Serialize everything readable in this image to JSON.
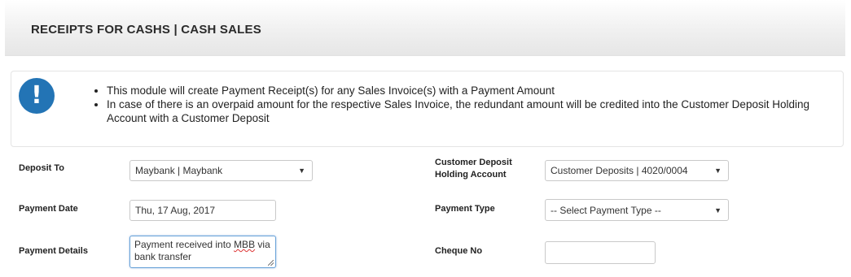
{
  "header": {
    "title": "RECEIPTS FOR CASHS | CASH SALES"
  },
  "notice": {
    "icon": "exclamation-icon",
    "items": [
      "This module will create Payment Receipt(s) for any Sales Invoice(s) with a Payment Amount",
      "In case of there is an overpaid amount for the respective Sales Invoice, the redundant amount will be credited into the Customer Deposit Holding Account with a Customer Deposit"
    ]
  },
  "form": {
    "deposit_to": {
      "label": "Deposit To",
      "value": "Maybank | Maybank"
    },
    "customer_deposit": {
      "label_line1": "Customer Deposit",
      "label_line2": "Holding Account",
      "value": "Customer Deposits | 4020/0004"
    },
    "payment_date": {
      "label": "Payment Date",
      "value": "Thu, 17 Aug, 2017"
    },
    "payment_type": {
      "label": "Payment Type",
      "value": "-- Select Payment Type --"
    },
    "payment_details": {
      "label": "Payment Details",
      "value_part1": "Payment received into ",
      "value_spell": "MBB",
      "value_part2": " via bank transfer"
    },
    "cheque_no": {
      "label": "Cheque No",
      "value": ""
    }
  },
  "colors": {
    "icon_blue": "#2374b5",
    "focus_border": "#6aa3d8"
  }
}
